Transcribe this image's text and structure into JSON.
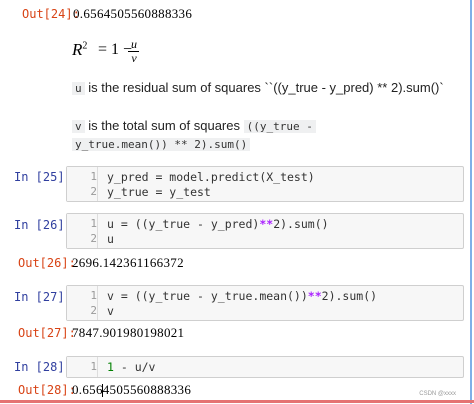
{
  "out24": {
    "prompt": "Out[24]:",
    "value": "0.6564505560888336"
  },
  "formula": {
    "lhs": "R",
    "exp": "2",
    "eq": "= 1 −",
    "num": "u",
    "den": "v"
  },
  "md_u": {
    "var": "u",
    "text": " is the residual sum of squares ``((y_true - y_pred) ** 2).sum()`"
  },
  "md_v": {
    "var": "v",
    "text": " is the total sum of squares",
    "code1": "((y_true -",
    "code2": "y_true.mean()) ** 2).sum()"
  },
  "in25": {
    "prompt": "In  [25]:",
    "lines": [
      "1",
      "2"
    ],
    "code": [
      "y_pred = model.predict(X_test)",
      "y_true = y_test"
    ]
  },
  "in26": {
    "prompt": "In  [26]:",
    "lines": [
      "1",
      "2"
    ],
    "code_a": "u = ((y_true - y_pred)",
    "op": "**",
    "code_b": "2).sum()",
    "code2": "u"
  },
  "out26": {
    "prompt": "Out[26]:",
    "value": "2696.142361166372"
  },
  "in27": {
    "prompt": "In  [27]:",
    "lines": [
      "1",
      "2"
    ],
    "code_a": "v = ((y_true - y_true.mean())",
    "op": "**",
    "code_b": "2).sum()",
    "code2": "v"
  },
  "out27": {
    "prompt": "Out[27]:",
    "value": "7847.901980198021"
  },
  "in28": {
    "prompt": "In  [28]:",
    "lines": [
      "1"
    ],
    "num": "1",
    "code": " - u/v"
  },
  "out28": {
    "prompt": "Out[28]:",
    "value": "0.6564505560888336"
  },
  "watermark": "CSDN @xxxx",
  "colors": {
    "out_prompt": "#d84315",
    "in_prompt": "#303f9f",
    "operator": "#aa22ff",
    "number": "#008000"
  }
}
